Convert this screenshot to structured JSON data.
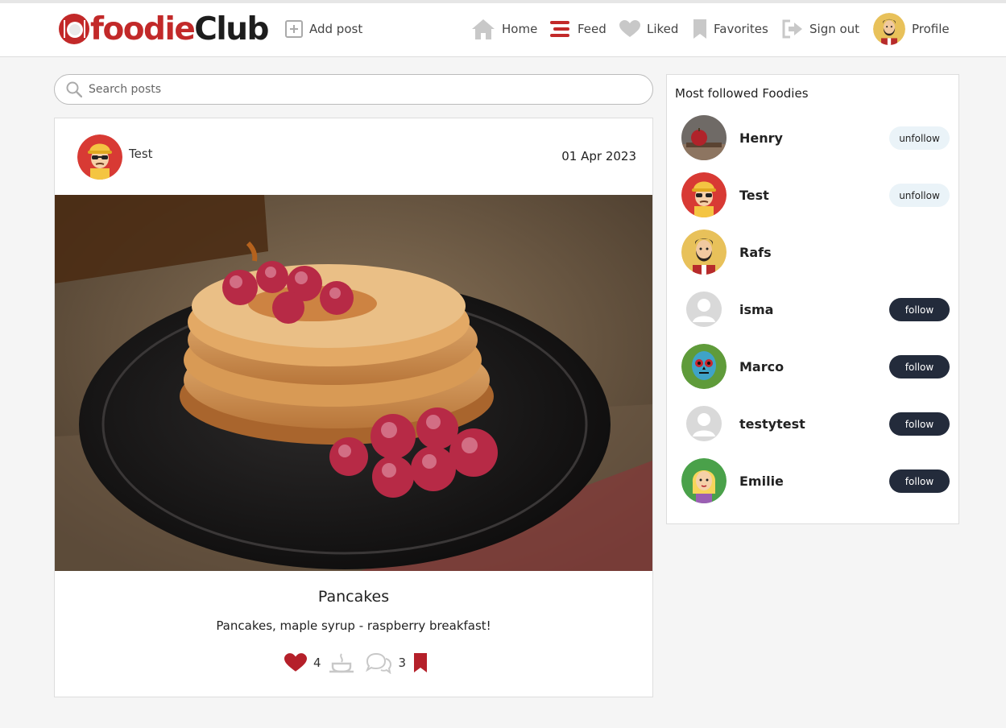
{
  "brand": {
    "name_part1": "foodie",
    "name_part2": "Club",
    "accent": "#c22929"
  },
  "nav": {
    "add_post": "Add post",
    "home": "Home",
    "feed": "Feed",
    "liked": "Liked",
    "favorites": "Favorites",
    "sign_out": "Sign out",
    "profile": "Profile"
  },
  "search": {
    "placeholder": "Search posts",
    "value": ""
  },
  "post": {
    "author": "Test",
    "date": "01 Apr 2023",
    "image_icon": "pancake-photo",
    "title": "Pancakes",
    "description": "Pancakes, maple syrup - raspberry breakfast!",
    "likes": "4",
    "comments": "3"
  },
  "sidebar": {
    "title": "Most followed Foodies",
    "foodies": [
      {
        "name": "Henry",
        "button": "unfollow",
        "avatar": "apple-avatar"
      },
      {
        "name": "Test",
        "button": "unfollow",
        "avatar": "worker-avatar"
      },
      {
        "name": "Rafs",
        "button": "",
        "avatar": "bearded-man-avatar"
      },
      {
        "name": "isma",
        "button": "follow",
        "avatar": "default-avatar"
      },
      {
        "name": "Marco",
        "button": "follow",
        "avatar": "skull-avatar"
      },
      {
        "name": "testytest",
        "button": "follow",
        "avatar": "default-avatar"
      },
      {
        "name": "Emilie",
        "button": "follow",
        "avatar": "blonde-girl-avatar"
      }
    ]
  }
}
